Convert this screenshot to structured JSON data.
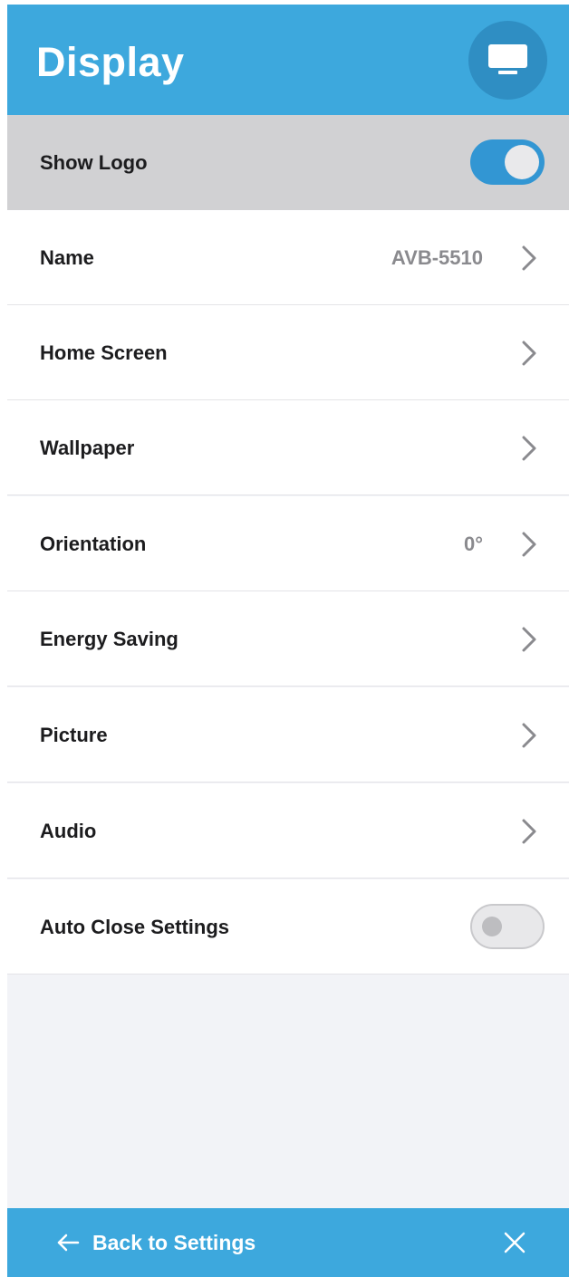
{
  "header": {
    "title": "Display",
    "icon": "monitor-icon"
  },
  "rows": [
    {
      "label": "Show Logo",
      "type": "toggle",
      "state": "on"
    },
    {
      "label": "Name",
      "value": "AVB-5510",
      "type": "link"
    },
    {
      "label": "Home Screen",
      "type": "link"
    },
    {
      "label": "Wallpaper",
      "type": "link"
    },
    {
      "label": "Orientation",
      "value": "0°",
      "type": "link"
    },
    {
      "label": "Energy Saving",
      "type": "link"
    },
    {
      "label": "Picture",
      "type": "link"
    },
    {
      "label": "Audio",
      "type": "link"
    },
    {
      "label": "Auto Close Settings",
      "type": "toggle",
      "state": "off"
    }
  ],
  "footer": {
    "back_label": "Back to Settings",
    "back_icon": "arrow-left-icon",
    "close_icon": "close-icon"
  },
  "colors": {
    "header_bg": "#3da8dd",
    "toggle_on": "#3296d3",
    "highlight_row": "#d1d1d3",
    "page_bg": "#f2f3f7"
  }
}
